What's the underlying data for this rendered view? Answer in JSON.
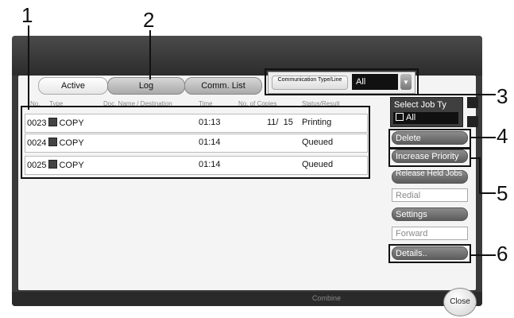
{
  "callouts": [
    "1",
    "2",
    "3",
    "4",
    "5",
    "6"
  ],
  "tabs": [
    {
      "label": "Active"
    },
    {
      "label": "Log"
    },
    {
      "label": "Comm. List"
    }
  ],
  "comm_type": {
    "label": "Communication Type/Line",
    "value": "All"
  },
  "columns": [
    "No.",
    "Type",
    "Doc. Name / Destination",
    "Time",
    "No. of Copies",
    "Status/Result"
  ],
  "rows": [
    {
      "no": "0023",
      "type": "COPY",
      "name": "",
      "time": "01:13",
      "copies": "11/  15",
      "status": "Printing"
    },
    {
      "no": "0024",
      "type": "COPY",
      "name": "",
      "time": "01:14",
      "copies": "",
      "status": "Queued"
    },
    {
      "no": "0025",
      "type": "COPY",
      "name": "",
      "time": "01:14",
      "copies": "",
      "status": "Queued"
    }
  ],
  "select_job_type": {
    "label": "Select Job Ty",
    "value": "All"
  },
  "buttons": {
    "delete": "Delete",
    "increase_priority": "Increase Priority",
    "release_held_jobs": "Release Held Jobs",
    "redial": "Redial",
    "settings": "Settings",
    "forward": "Forward",
    "details": "Details..",
    "close": "Close"
  },
  "bottom_bar": {
    "combine": "Combine"
  },
  "colors": {
    "screen_bg": "#3a3a3a",
    "panel_bg": "#f4f4f4",
    "button_gray": "#6e6e6e",
    "highlight_border": "#111111"
  }
}
